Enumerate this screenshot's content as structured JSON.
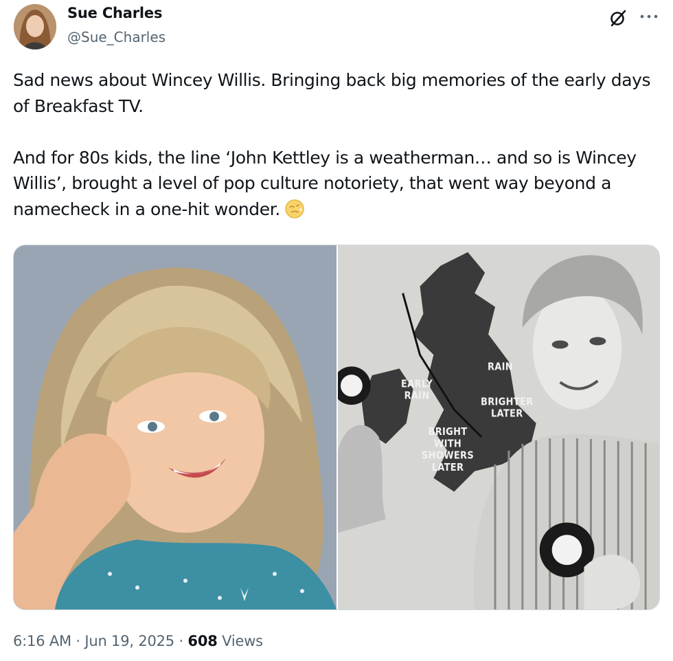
{
  "author": {
    "display_name": "Sue Charles",
    "handle": "@Sue_Charles"
  },
  "icons": {
    "grok": "grok-icon",
    "more": "more-horizontal-icon",
    "emoji": "thinking-sparkle-emoji"
  },
  "post": {
    "paragraph_1": "Sad news about Wincey Willis. Bringing back big memories of the early days of Breakfast TV.",
    "paragraph_2": "And for 80s kids, the line ‘John Kettley is a weatherman… and so is Wincey Willis’, brought a level of pop culture notoriety, that went way beyond a namecheck in a one-hit wonder."
  },
  "media": {
    "map_labels": {
      "early_rain": "EARLY\nRAIN",
      "rain": "RAIN",
      "brighter_later": "BRIGHTER\nLATER",
      "bright_with_showers": "BRIGHT\nWITH\nSHOWERS\nLATER"
    }
  },
  "meta": {
    "time": "6:16 AM",
    "separator": " · ",
    "date": "Jun 19, 2025",
    "views_count": "608",
    "views_label": " Views"
  },
  "colors": {
    "text_primary": "#0f1419",
    "text_secondary": "#536471",
    "border": "#cfd9de"
  }
}
